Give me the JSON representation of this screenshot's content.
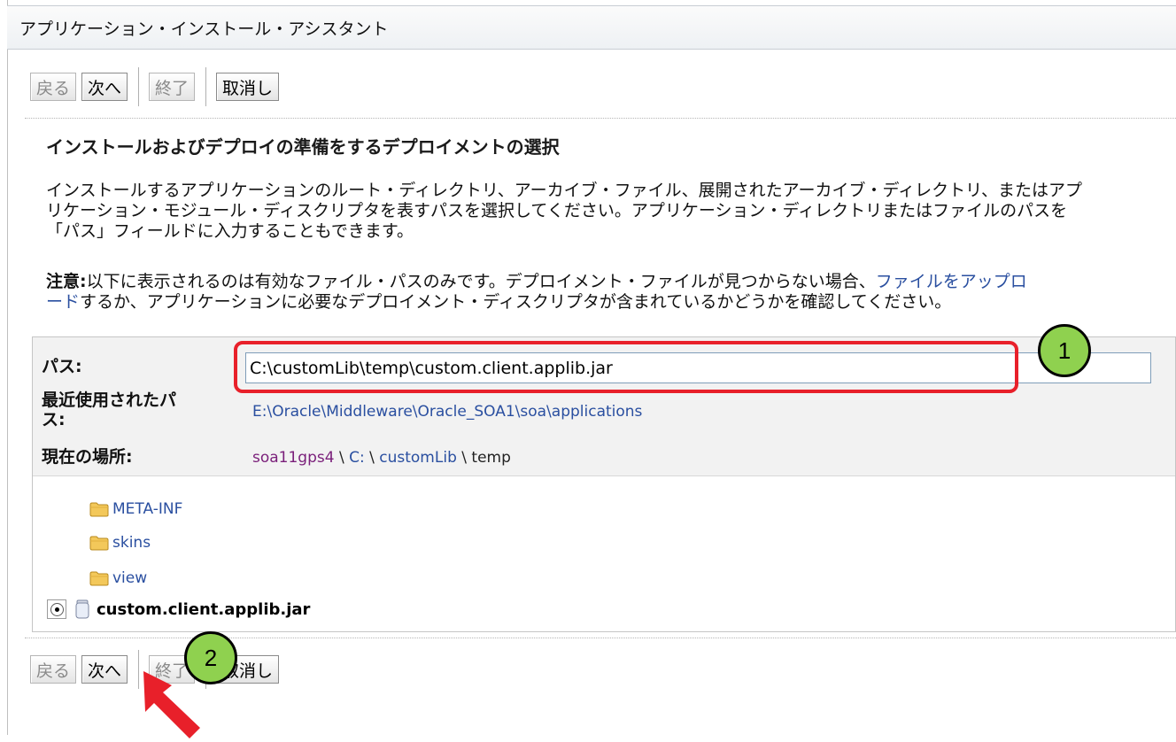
{
  "window": {
    "title": "アプリケーション・インストール・アシスタント"
  },
  "toolbar": {
    "back_label": "戻る",
    "next_label": "次へ",
    "finish_label": "終了",
    "cancel_label": "取消し"
  },
  "main": {
    "heading": "インストールおよびデプロイの準備をするデプロイメントの選択",
    "description_line1": "インストールするアプリケーションのルート・ディレクトリ、アーカイブ・ファイル、展開されたアーカイブ・ディレクトリ、またはアプ",
    "description_line2": "リケーション・モジュール・ディスクリプタを表すパスを選択してください。アプリケーション・ディレクトリまたはファイルのパスを",
    "description_line3": "「パス」フィールドに入力することもできます。",
    "note_label": "注意:",
    "note_text1": "以下に表示されるのは有効なファイル・パスのみです。デプロイメント・ファイルが見つからない場合、",
    "note_link1": "ファイルをアップロ",
    "note_link2": "ード",
    "note_text2": "するか、アプリケーションに必要なデプロイメント・ディスクリプタが含まれているかどうかを確認してください。"
  },
  "path_panel": {
    "path_label": "パス:",
    "path_value": "C:\\customLib\\temp\\custom.client.applib.jar",
    "recent_label_line1": "最近使用されたパ",
    "recent_label_line2": "ス:",
    "recent_path": "E:\\Oracle\\Middleware\\Oracle_SOA1\\soa\\applications",
    "location_label": "現在の場所:",
    "location_host": "soa11gps4",
    "location_sep1": " \\ ",
    "location_drive": "C:",
    "location_sep2": " \\ ",
    "location_dir": "customLib",
    "location_sep3": " \\ ",
    "location_current": "temp"
  },
  "tree": {
    "items": [
      {
        "label": "META-INF",
        "type": "folder"
      },
      {
        "label": "skins",
        "type": "folder"
      },
      {
        "label": "view",
        "type": "folder"
      },
      {
        "label": "custom.client.applib.jar",
        "type": "jar",
        "selected": true
      }
    ]
  },
  "annotations": {
    "callout_1": "1",
    "callout_2": "2",
    "highlight_color": "#e8202a",
    "callout_color": "#8fd14f",
    "arrow_color": "#e8202a"
  }
}
